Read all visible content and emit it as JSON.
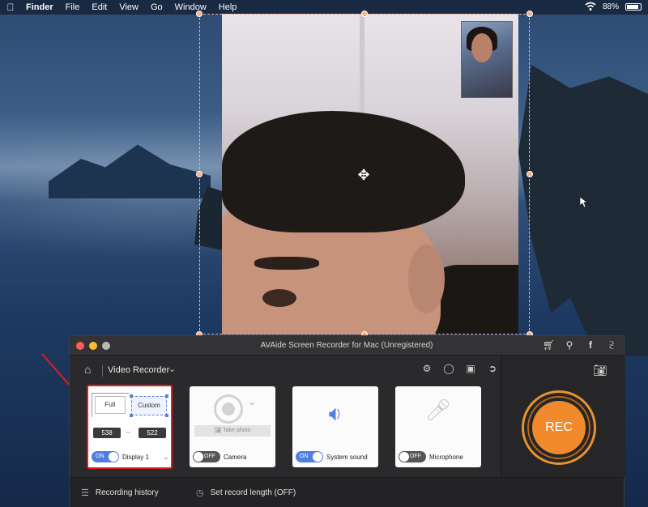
{
  "menubar": {
    "apple_icon": "",
    "items": [
      "Finder",
      "File",
      "Edit",
      "View",
      "Go",
      "Window",
      "Help"
    ],
    "battery_text": "88%",
    "battery_level": 0.88
  },
  "recorder": {
    "window_title": "AVAide Screen Recorder for Mac (Unregistered)",
    "mode_label": "Video Recorder",
    "area": {
      "full_label": "Full",
      "custom_label": "Custom",
      "width_value": "538",
      "height_value": "522",
      "toggle_text": "ON",
      "display_label": "Display 1"
    },
    "camera": {
      "take_photo_label": "Take photo",
      "toggle_text": "OFF",
      "label": "Camera"
    },
    "system_sound": {
      "toggle_text": "ON",
      "label": "System sound"
    },
    "microphone": {
      "toggle_text": "OFF",
      "label": "Microphone"
    },
    "rec_label": "REC",
    "bottom": {
      "history_label": "Recording history",
      "record_length_label": "Set record length (OFF)"
    }
  },
  "colors": {
    "accent": "#f08a2c",
    "toggle_on": "#4f7fe0",
    "highlight": "#e21d1d"
  }
}
